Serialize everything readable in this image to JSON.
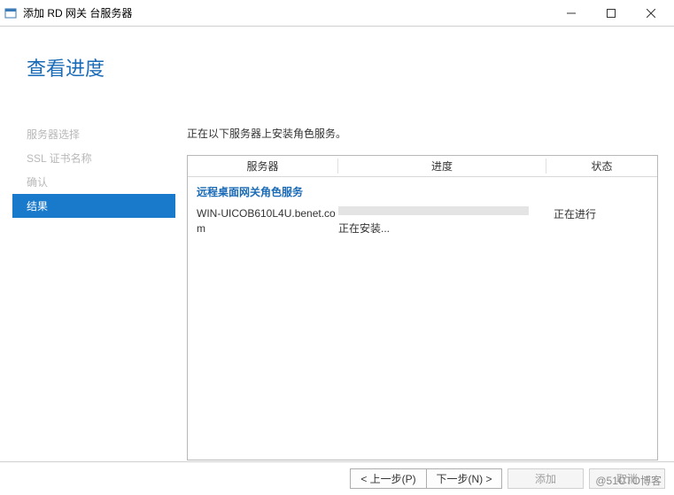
{
  "window": {
    "title": "添加 RD 网关 台服务器"
  },
  "page": {
    "title": "查看进度"
  },
  "sidebar": {
    "items": [
      {
        "label": "服务器选择"
      },
      {
        "label": "SSL 证书名称"
      },
      {
        "label": "确认"
      },
      {
        "label": "结果"
      }
    ]
  },
  "main": {
    "install_message": "正在以下服务器上安装角色服务。",
    "columns": {
      "server": "服务器",
      "progress": "进度",
      "status": "状态"
    },
    "service_group": "远程桌面网关角色服务",
    "rows": [
      {
        "server": "WIN-UICOB610L4U.benet.com",
        "progress_text": "正在安装...",
        "status": "正在进行"
      }
    ]
  },
  "footer": {
    "prev": "< 上一步(P)",
    "next": "下一步(N) >",
    "add": "添加",
    "cancel": "取消"
  },
  "watermark": "@51CTO博客"
}
